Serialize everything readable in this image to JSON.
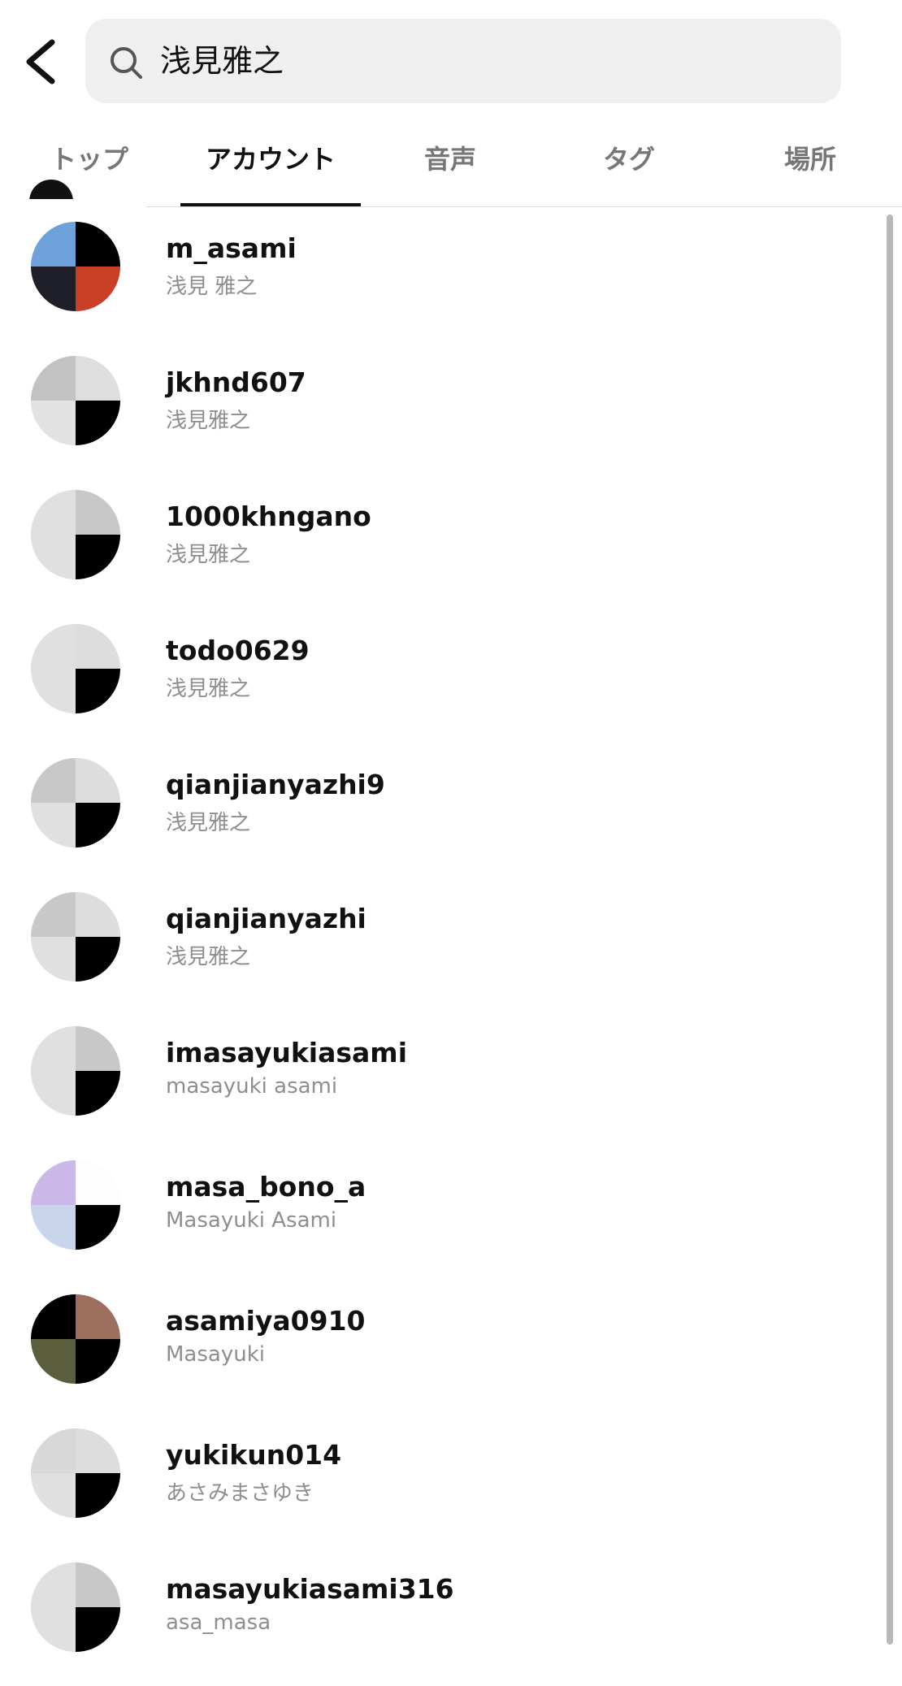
{
  "search": {
    "query": "浅見雅之"
  },
  "tabs": [
    {
      "label": "トップ"
    },
    {
      "label": "アカウント"
    },
    {
      "label": "音声"
    },
    {
      "label": "タグ"
    },
    {
      "label": "場所"
    }
  ],
  "active_tab": "アカウント",
  "results": [
    {
      "username": "m_asami",
      "name": "浅見 雅之",
      "avatar": [
        "#6fa2dd",
        "#000000",
        "#1f1f2a",
        "#cb3f26"
      ]
    },
    {
      "username": "jkhnd607",
      "name": "浅見雅之",
      "avatar": [
        "#c2c2c2",
        "#dedede",
        "#e2e2e2",
        "#000000"
      ]
    },
    {
      "username": "1000khngano",
      "name": "浅見雅之",
      "avatar": [
        "#e0e0e0",
        "#c8c8c8",
        "#e0e0e0",
        "#000000"
      ]
    },
    {
      "username": "todo0629",
      "name": "浅見雅之",
      "avatar": [
        "#e0e0e0",
        "#dddddd",
        "#e0e0e0",
        "#000000"
      ]
    },
    {
      "username": "qianjianyazhi9",
      "name": "浅見雅之",
      "avatar": [
        "#c8c8c8",
        "#dddddd",
        "#e0e0e0",
        "#000000"
      ]
    },
    {
      "username": "qianjianyazhi",
      "name": "浅見雅之",
      "avatar": [
        "#c8c8c8",
        "#dddddd",
        "#e0e0e0",
        "#000000"
      ]
    },
    {
      "username": "imasayukiasami",
      "name": "masayuki asami",
      "avatar": [
        "#e0e0e0",
        "#c8c8c8",
        "#e0e0e0",
        "#000000"
      ]
    },
    {
      "username": "masa_bono_a",
      "name": "Masayuki Asami",
      "avatar": [
        "#cbb8e8",
        "#fdfdfd",
        "#c9d5ea",
        "#000000"
      ]
    },
    {
      "username": "asamiya0910",
      "name": "Masayuki",
      "avatar": [
        "#000000",
        "#9b6e5d",
        "#5b5e3c",
        "#000000"
      ]
    },
    {
      "username": "yukikun014",
      "name": "あさみまさゆき",
      "avatar": [
        "#d8d8d8",
        "#dddddd",
        "#e0e0e0",
        "#000000"
      ]
    },
    {
      "username": "masayukiasami316",
      "name": "asa_masa",
      "avatar": [
        "#e0e0e0",
        "#c8c8c8",
        "#e0e0e0",
        "#000000"
      ]
    }
  ]
}
